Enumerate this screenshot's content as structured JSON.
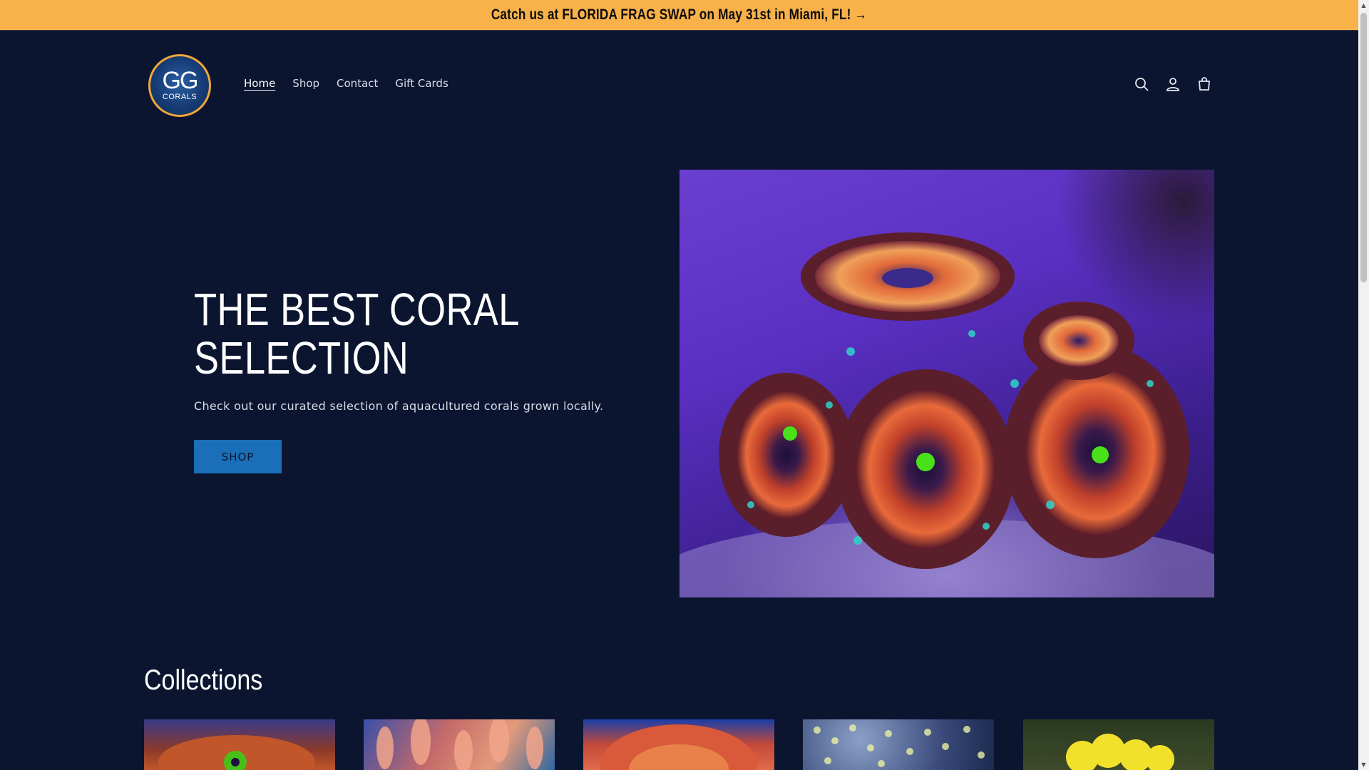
{
  "announcement": {
    "text": "Catch us at FLORIDA FRAG SWAP on May 31st in Miami, FL! →"
  },
  "header": {
    "logo": {
      "top": "GG",
      "bottom": "CORALS"
    },
    "nav": [
      {
        "label": "Home",
        "active": true
      },
      {
        "label": "Shop",
        "active": false
      },
      {
        "label": "Contact",
        "active": false
      },
      {
        "label": "Gift Cards",
        "active": false
      }
    ],
    "icons": [
      "search-icon",
      "account-icon",
      "cart-icon"
    ]
  },
  "hero": {
    "title_line1": "THE BEST CORAL",
    "title_line2": "SELECTION",
    "subtitle": "Check out our curated selection of aquacultured corals grown locally.",
    "button_label": "SHOP"
  },
  "collections": {
    "title": "Collections",
    "cards": 5
  },
  "colors": {
    "background": "#0b1530",
    "announcement_bg": "#f9b24a",
    "accent_button": "#1a6fb8",
    "logo_ring": "#f0a73a"
  }
}
